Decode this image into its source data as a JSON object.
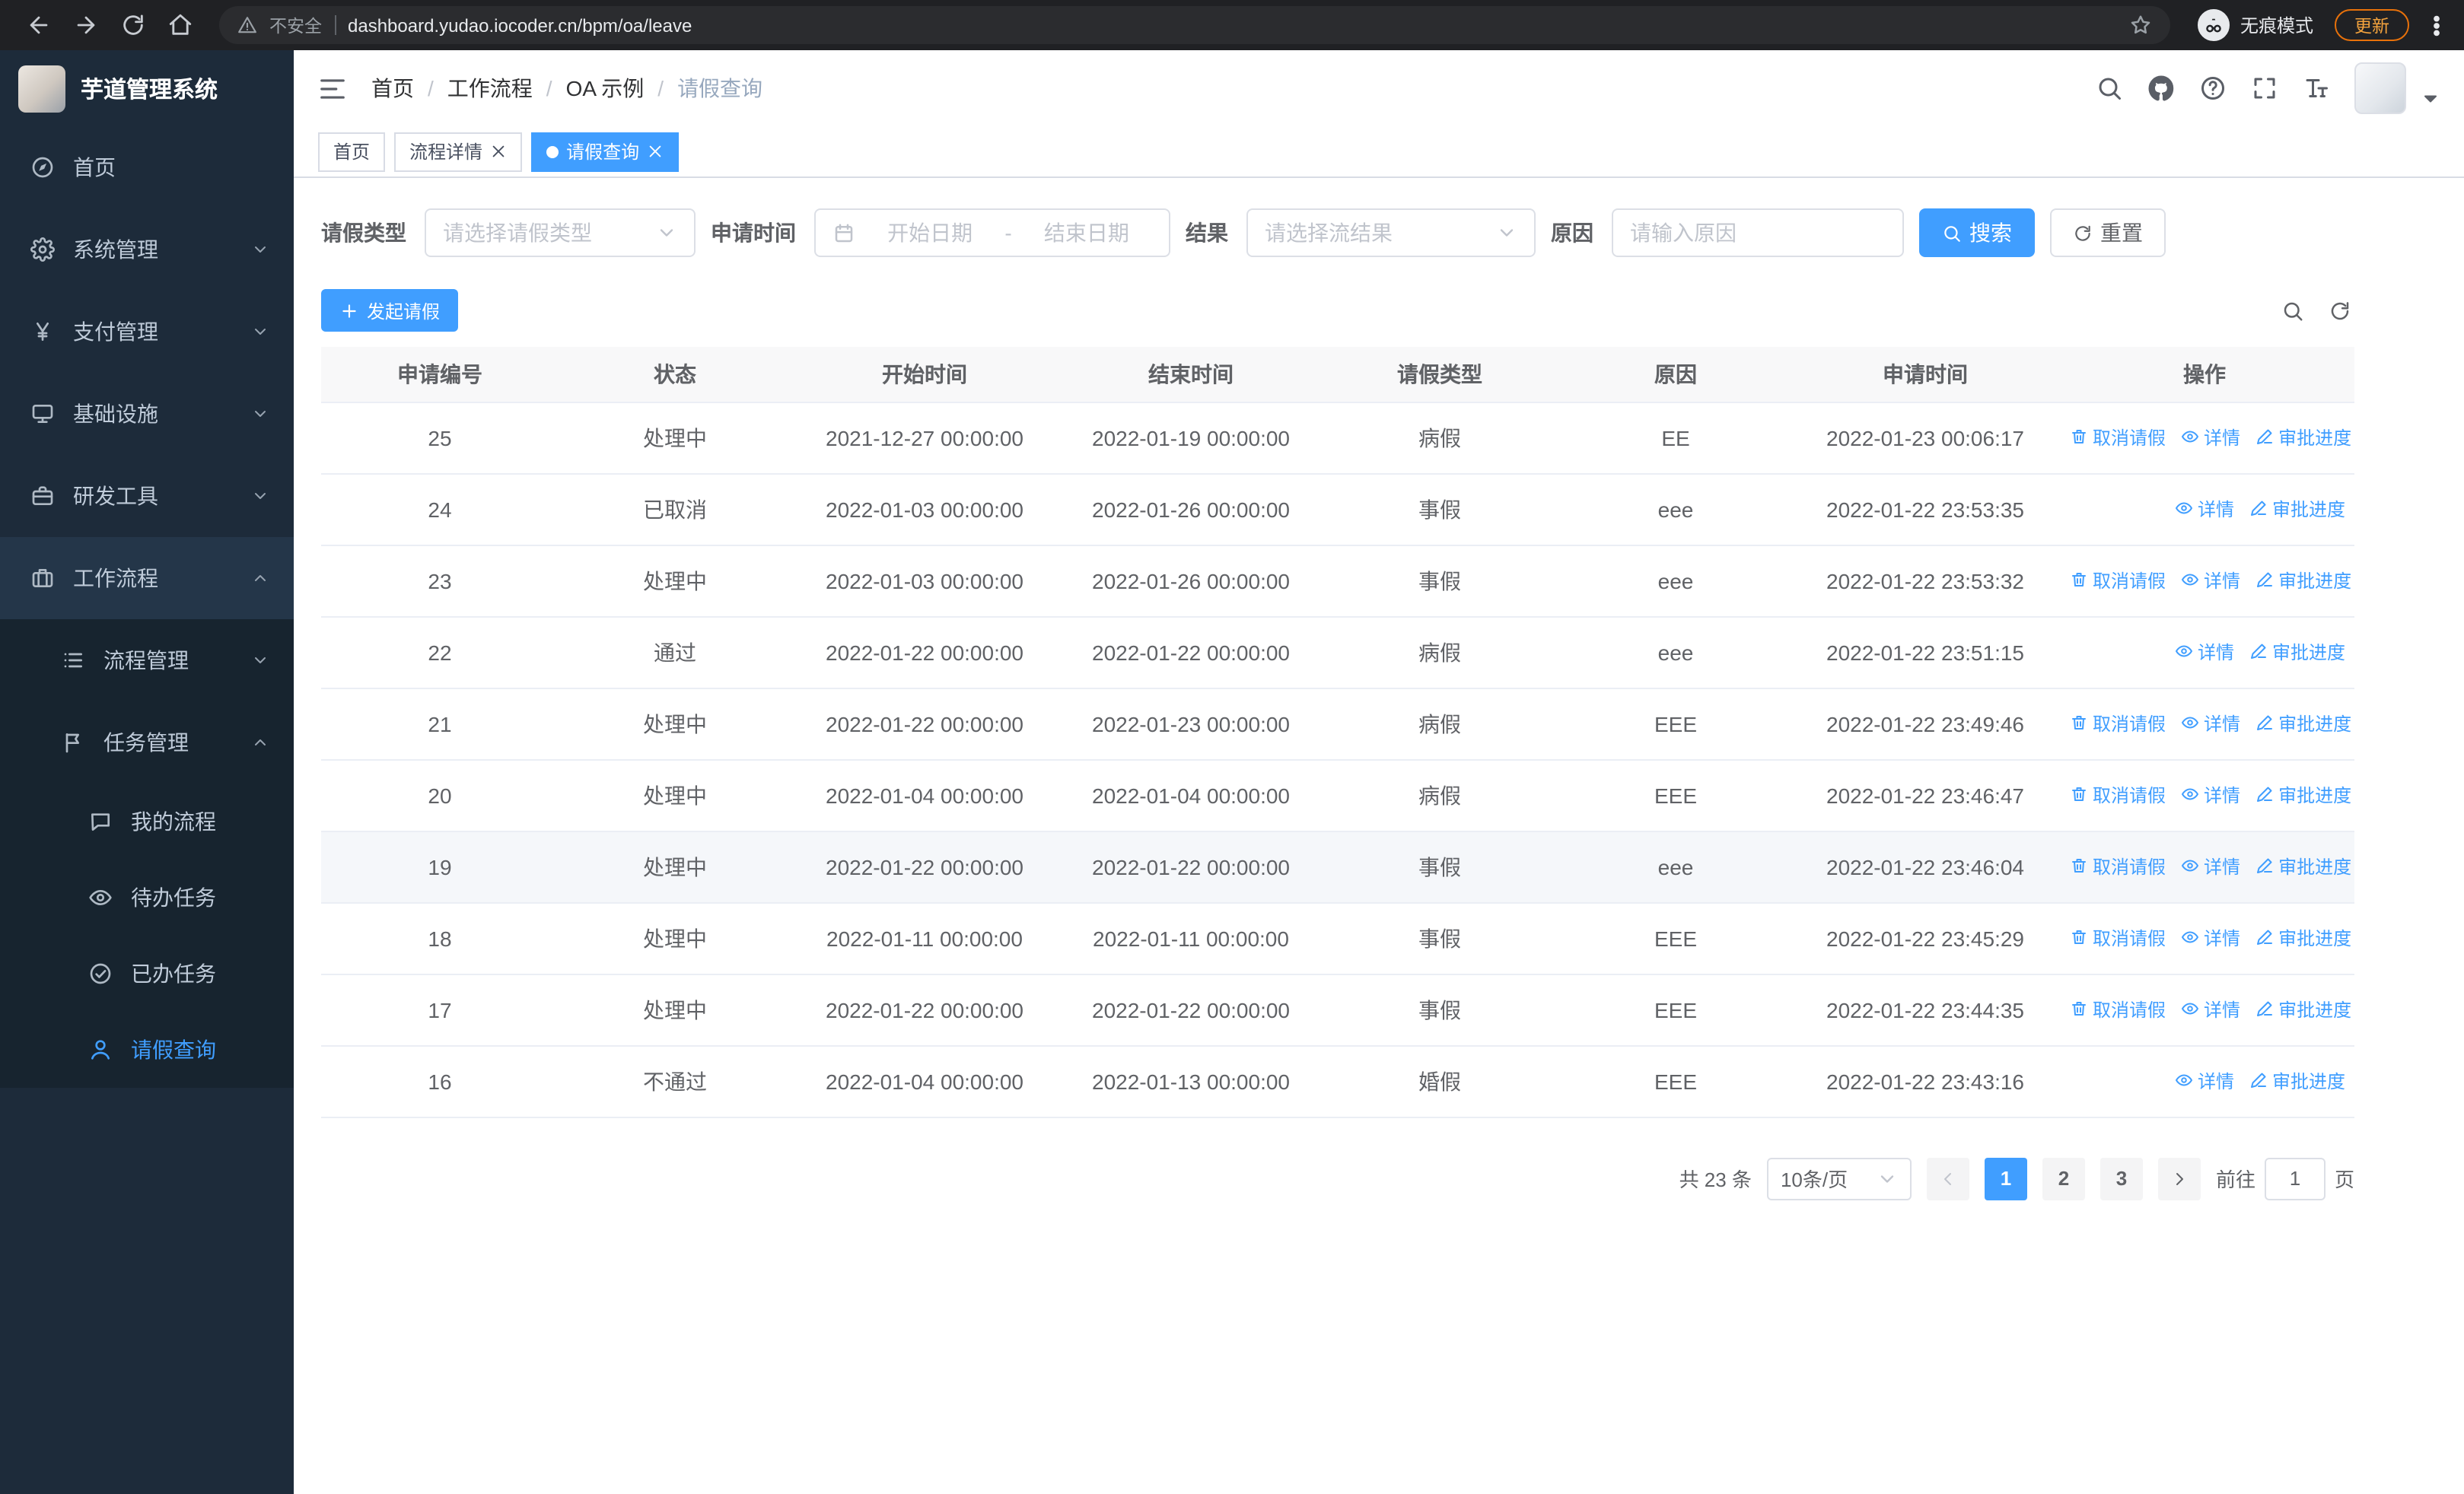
{
  "colors": {
    "accent": "#409eff",
    "sidebar_bg": "#1d2b3a",
    "chrome_bg": "#202124"
  },
  "browser": {
    "security_text": "不安全",
    "url": "dashboard.yudao.iocoder.cn/bpm/oa/leave",
    "incognito_text": "无痕模式",
    "update_text": "更新"
  },
  "sidebar": {
    "title": "芋道管理系统",
    "items": [
      {
        "label": "首页",
        "icon": "dashboard-icon",
        "level": 1
      },
      {
        "label": "系统管理",
        "icon": "gear-icon",
        "level": 1,
        "chevron": "down"
      },
      {
        "label": "支付管理",
        "icon": "yen-icon",
        "level": 1,
        "chevron": "down"
      },
      {
        "label": "基础设施",
        "icon": "monitor-icon",
        "level": 1,
        "chevron": "down"
      },
      {
        "label": "研发工具",
        "icon": "briefcase-icon",
        "level": 1,
        "chevron": "down"
      },
      {
        "label": "工作流程",
        "icon": "suitcase-icon",
        "level": 1,
        "chevron": "up",
        "section_active": true
      },
      {
        "label": "流程管理",
        "icon": "list-icon",
        "level": 2,
        "chevron": "down"
      },
      {
        "label": "任务管理",
        "icon": "flag-icon",
        "level": 2,
        "chevron": "up"
      },
      {
        "label": "我的流程",
        "icon": "chat-icon",
        "level": 3
      },
      {
        "label": "待办任务",
        "icon": "eye-icon",
        "level": 3
      },
      {
        "label": "已办任务",
        "icon": "check-circle-icon",
        "level": 3
      },
      {
        "label": "请假查询",
        "icon": "user-icon",
        "level": 3,
        "active": true
      }
    ]
  },
  "navbar": {
    "breadcrumbs": [
      "首页",
      "工作流程",
      "OA 示例",
      "请假查询"
    ]
  },
  "tabs": [
    {
      "label": "首页",
      "closable": false,
      "active": false
    },
    {
      "label": "流程详情",
      "closable": true,
      "active": false
    },
    {
      "label": "请假查询",
      "closable": true,
      "active": true
    }
  ],
  "filters": {
    "leave_type": {
      "label": "请假类型",
      "placeholder": "请选择请假类型"
    },
    "apply_time": {
      "label": "申请时间",
      "start_placeholder": "开始日期",
      "separator": "-",
      "end_placeholder": "结束日期"
    },
    "result": {
      "label": "结果",
      "placeholder": "请选择流结果"
    },
    "reason": {
      "label": "原因",
      "placeholder": "请输入原因"
    },
    "search_button": "搜索",
    "reset_button": "重置"
  },
  "toolbar": {
    "create_button": "发起请假"
  },
  "table": {
    "headers": [
      "申请编号",
      "状态",
      "开始时间",
      "结束时间",
      "请假类型",
      "原因",
      "申请时间",
      "操作"
    ],
    "action_labels": {
      "cancel": "取消请假",
      "detail": "详情",
      "progress": "审批进度"
    },
    "rows": [
      {
        "no": "25",
        "status": "处理中",
        "start_time": "2021-12-27 00:00:00",
        "end_time": "2022-01-19 00:00:00",
        "leave_type": "病假",
        "reason": "EE",
        "apply_time": "2022-01-23 00:06:17",
        "actions": [
          "cancel",
          "detail",
          "progress"
        ],
        "highlighted": false
      },
      {
        "no": "24",
        "status": "已取消",
        "start_time": "2022-01-03 00:00:00",
        "end_time": "2022-01-26 00:00:00",
        "leave_type": "事假",
        "reason": "eee",
        "apply_time": "2022-01-22 23:53:35",
        "actions": [
          "detail",
          "progress"
        ],
        "highlighted": false
      },
      {
        "no": "23",
        "status": "处理中",
        "start_time": "2022-01-03 00:00:00",
        "end_time": "2022-01-26 00:00:00",
        "leave_type": "事假",
        "reason": "eee",
        "apply_time": "2022-01-22 23:53:32",
        "actions": [
          "cancel",
          "detail",
          "progress"
        ],
        "highlighted": false
      },
      {
        "no": "22",
        "status": "通过",
        "start_time": "2022-01-22 00:00:00",
        "end_time": "2022-01-22 00:00:00",
        "leave_type": "病假",
        "reason": "eee",
        "apply_time": "2022-01-22 23:51:15",
        "actions": [
          "detail",
          "progress"
        ],
        "highlighted": false
      },
      {
        "no": "21",
        "status": "处理中",
        "start_time": "2022-01-22 00:00:00",
        "end_time": "2022-01-23 00:00:00",
        "leave_type": "病假",
        "reason": "EEE",
        "apply_time": "2022-01-22 23:49:46",
        "actions": [
          "cancel",
          "detail",
          "progress"
        ],
        "highlighted": false
      },
      {
        "no": "20",
        "status": "处理中",
        "start_time": "2022-01-04 00:00:00",
        "end_time": "2022-01-04 00:00:00",
        "leave_type": "病假",
        "reason": "EEE",
        "apply_time": "2022-01-22 23:46:47",
        "actions": [
          "cancel",
          "detail",
          "progress"
        ],
        "highlighted": false
      },
      {
        "no": "19",
        "status": "处理中",
        "start_time": "2022-01-22 00:00:00",
        "end_time": "2022-01-22 00:00:00",
        "leave_type": "事假",
        "reason": "eee",
        "apply_time": "2022-01-22 23:46:04",
        "actions": [
          "cancel",
          "detail",
          "progress"
        ],
        "highlighted": true
      },
      {
        "no": "18",
        "status": "处理中",
        "start_time": "2022-01-11 00:00:00",
        "end_time": "2022-01-11 00:00:00",
        "leave_type": "事假",
        "reason": "EEE",
        "apply_time": "2022-01-22 23:45:29",
        "actions": [
          "cancel",
          "detail",
          "progress"
        ],
        "highlighted": false
      },
      {
        "no": "17",
        "status": "处理中",
        "start_time": "2022-01-22 00:00:00",
        "end_time": "2022-01-22 00:00:00",
        "leave_type": "事假",
        "reason": "EEE",
        "apply_time": "2022-01-22 23:44:35",
        "actions": [
          "cancel",
          "detail",
          "progress"
        ],
        "highlighted": false
      },
      {
        "no": "16",
        "status": "不通过",
        "start_time": "2022-01-04 00:00:00",
        "end_time": "2022-01-13 00:00:00",
        "leave_type": "婚假",
        "reason": "EEE",
        "apply_time": "2022-01-22 23:43:16",
        "actions": [
          "detail",
          "progress"
        ],
        "highlighted": false
      }
    ]
  },
  "pagination": {
    "total": "共 23 条",
    "page_size": "10条/页",
    "pages": [
      "1",
      "2",
      "3"
    ],
    "active_page": "1",
    "goto_prefix": "前往",
    "goto_value": "1",
    "goto_suffix": "页"
  }
}
